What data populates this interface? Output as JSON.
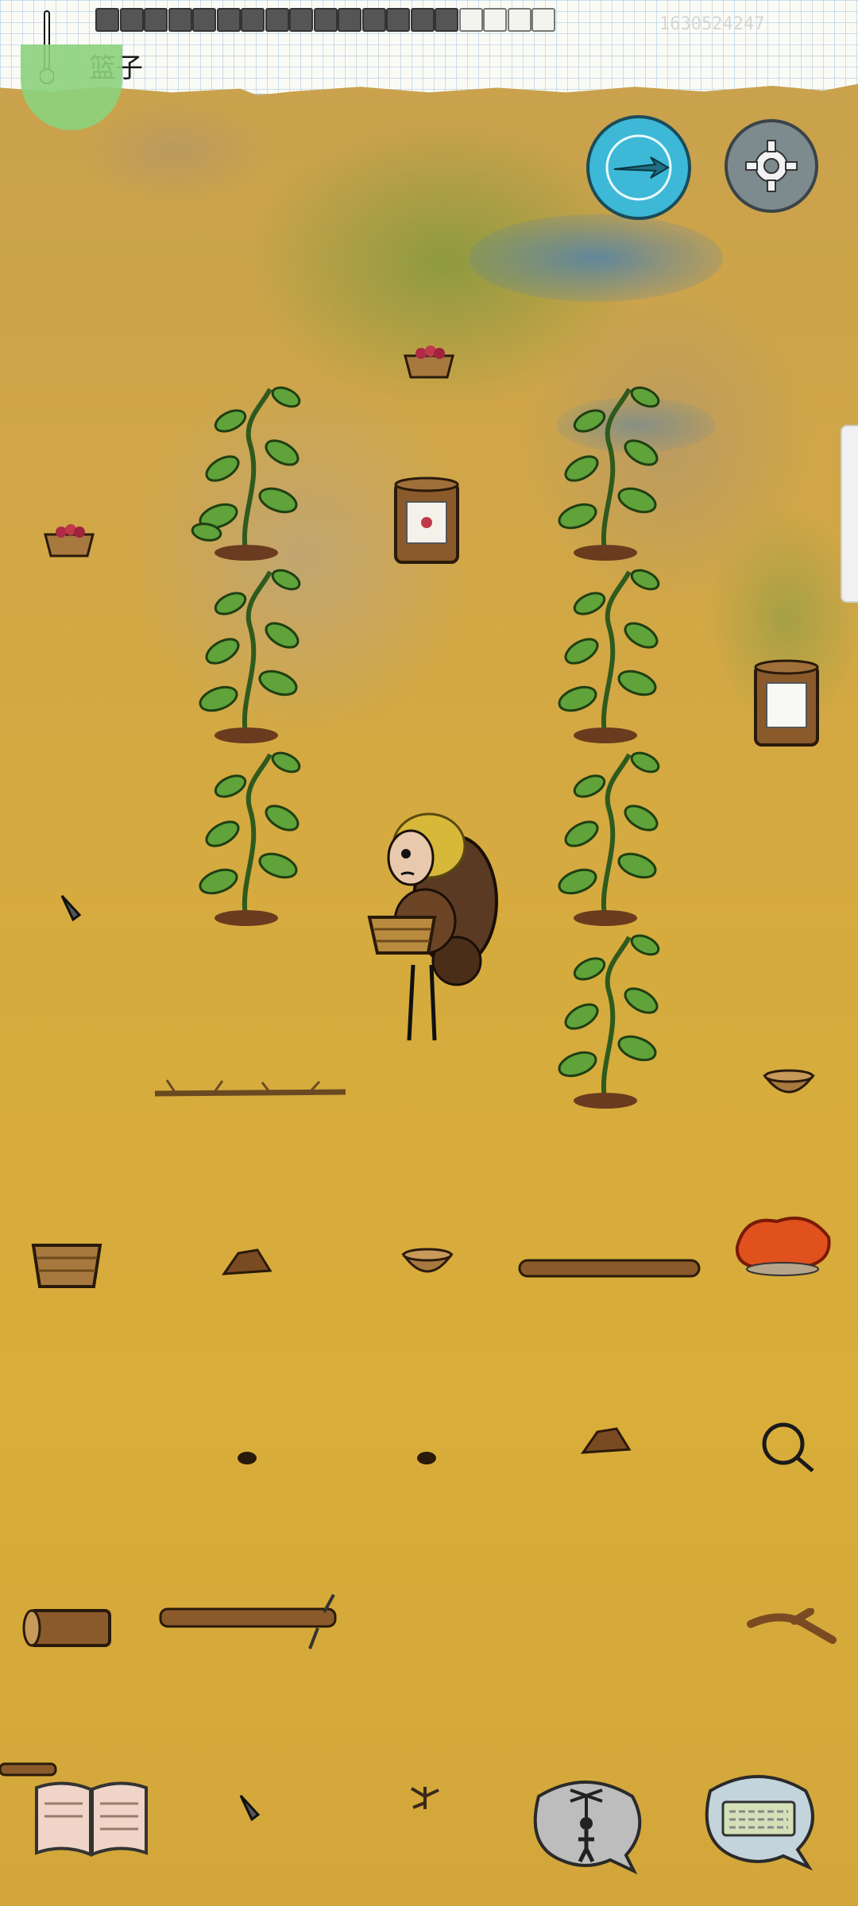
{
  "hud": {
    "held_item_label": "篮子",
    "faint_code": "1630524247",
    "inventory_slots": [
      "filled",
      "filled",
      "filled",
      "filled",
      "filled",
      "filled",
      "filled",
      "filled",
      "filled",
      "filled",
      "filled",
      "filled",
      "filled",
      "filled",
      "filled",
      "empty",
      "empty",
      "empty",
      "empty"
    ],
    "icons": {
      "temperature": "thermometer-icon",
      "compass": "compass-arrow-icon",
      "settings": "gear-icon",
      "tech_book": "open-book-icon",
      "emote": "puppet-speech-bubble-icon",
      "chat": "keyboard-speech-bubble-icon"
    }
  },
  "colors": {
    "compass_blue": "#3db8d6",
    "settings_gray": "#7d8a8e",
    "status_green": "#8cd17d",
    "grass": "#d6ab3e"
  },
  "world_objects": [
    "berry-bush",
    "berry-bush",
    "berry-bush",
    "berry-bush",
    "berry-bush",
    "berry-bush",
    "berry-bush",
    "clay-jar",
    "clay-jar",
    "berry-basket",
    "berry-basket",
    "wicker-basket",
    "clay-bowl",
    "bowl",
    "log",
    "long-straight-branch",
    "curved-branch",
    "rope",
    "firewood-log",
    "sharp-stone",
    "player-character"
  ]
}
